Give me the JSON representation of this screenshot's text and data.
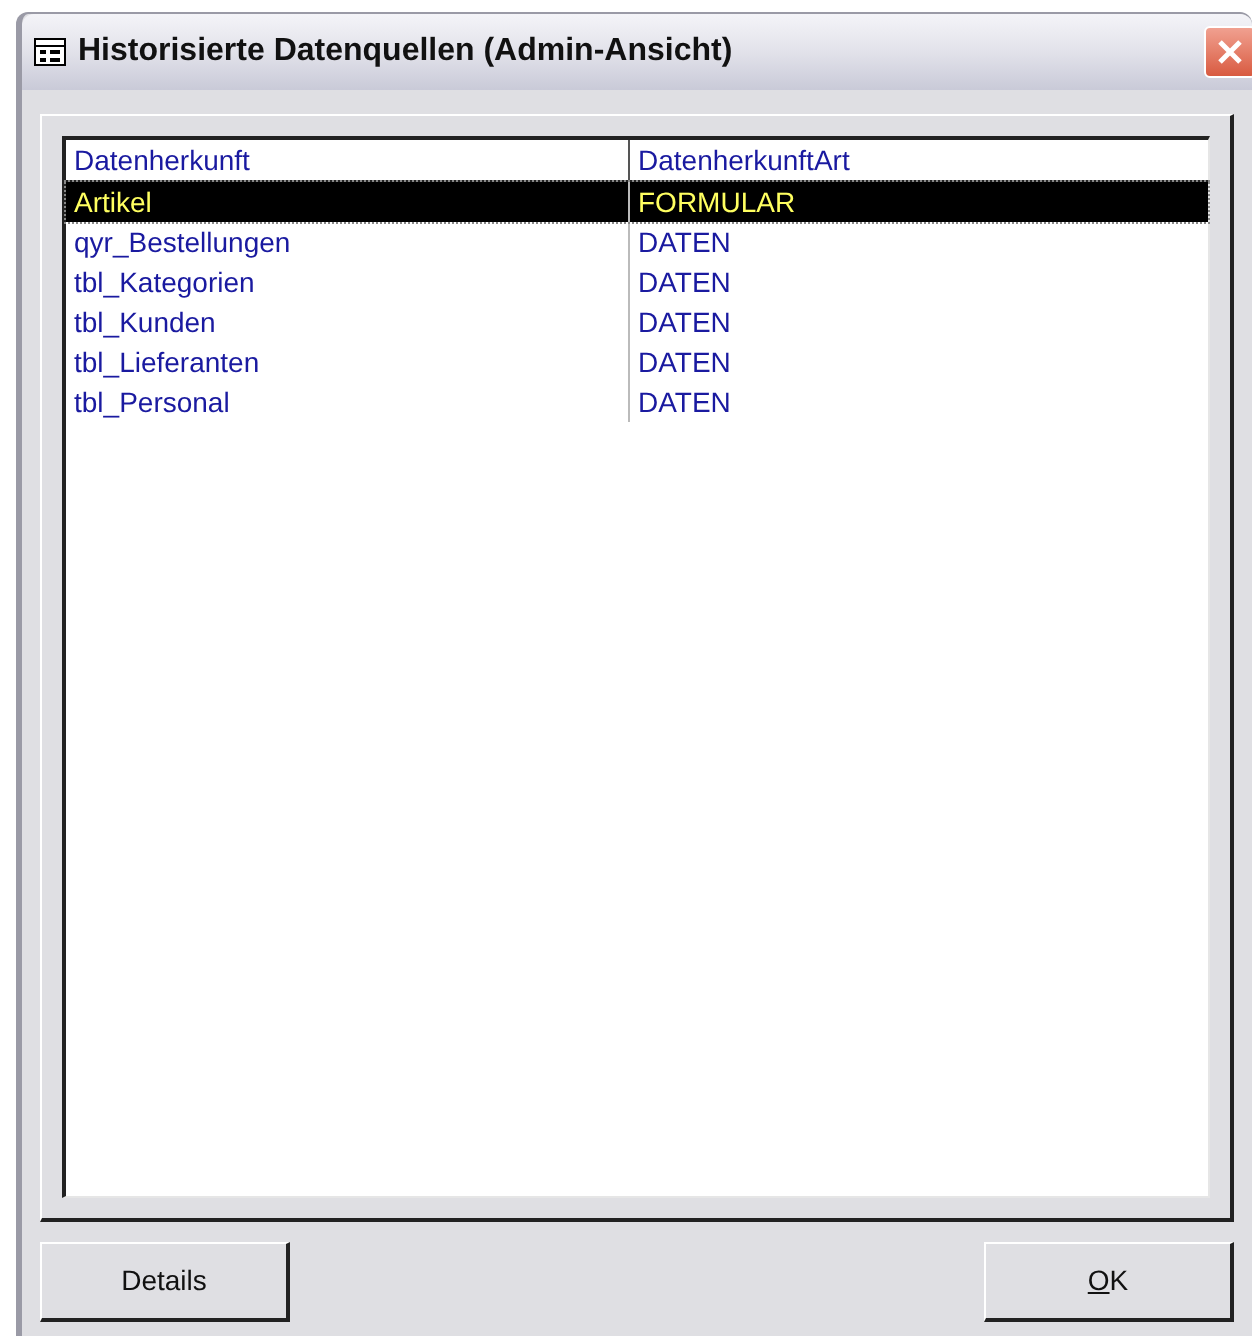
{
  "window": {
    "title": "Historisierte Datenquellen (Admin-Ansicht)"
  },
  "table": {
    "columns": [
      "Datenherkunft",
      "DatenherkunftArt"
    ],
    "rows": [
      {
        "cells": [
          "Artikel",
          "FORMULAR"
        ],
        "selected": true
      },
      {
        "cells": [
          "qyr_Bestellungen",
          "DATEN"
        ],
        "selected": false
      },
      {
        "cells": [
          "tbl_Kategorien",
          "DATEN"
        ],
        "selected": false
      },
      {
        "cells": [
          "tbl_Kunden",
          "DATEN"
        ],
        "selected": false
      },
      {
        "cells": [
          "tbl_Lieferanten",
          "DATEN"
        ],
        "selected": false
      },
      {
        "cells": [
          "tbl_Personal",
          "DATEN"
        ],
        "selected": false
      }
    ]
  },
  "buttons": [
    {
      "label": "Details",
      "mnemonic": false
    },
    {
      "label": "OK",
      "mnemonic": true
    }
  ]
}
